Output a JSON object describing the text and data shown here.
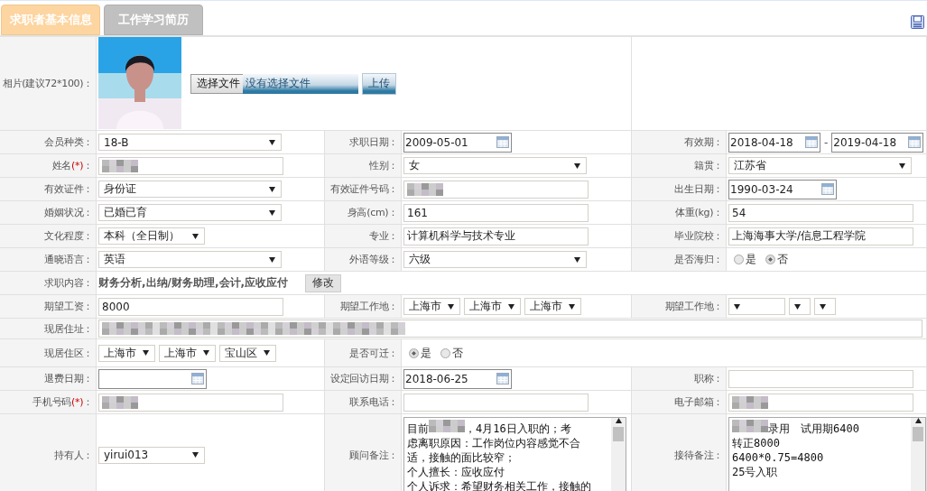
{
  "tabs": [
    {
      "label": "求职者基本信息",
      "selected": true
    },
    {
      "label": "工作学习简历",
      "selected": false
    }
  ],
  "photo": {
    "label": "相片(建议72*100)：",
    "file_button": "选择文件",
    "file_status": "没有选择文件",
    "upload_button": "上传"
  },
  "rows": [
    [
      {
        "label": "会员种类：",
        "field": {
          "kind": "select",
          "value": "18-B"
        }
      },
      {
        "label": "求职日期：",
        "field": {
          "kind": "date",
          "value": "2009-05-01"
        }
      },
      {
        "label": "有效期：",
        "field": {
          "kind": "daterange",
          "from": "2018-04-18",
          "separator": "-",
          "to": "2019-04-18"
        }
      }
    ],
    [
      {
        "label": "姓名",
        "mark": "(*)",
        "suffix": "：",
        "field": {
          "kind": "blurred"
        }
      },
      {
        "label": "性别：",
        "field": {
          "kind": "select",
          "value": "女"
        }
      },
      {
        "label": "籍贯：",
        "field": {
          "kind": "select",
          "value": "江苏省"
        }
      }
    ],
    [
      {
        "label": "有效证件：",
        "field": {
          "kind": "select",
          "value": "身份证"
        }
      },
      {
        "label": "有效证件号码：",
        "field": {
          "kind": "blurred"
        }
      },
      {
        "label": "出生日期：",
        "field": {
          "kind": "date",
          "value": "1990-03-24"
        }
      }
    ],
    [
      {
        "label": "婚姻状况：",
        "field": {
          "kind": "select",
          "value": "已婚已育"
        }
      },
      {
        "label": "身高(cm)：",
        "field": {
          "kind": "text",
          "value": "161"
        }
      },
      {
        "label": "体重(kg)：",
        "field": {
          "kind": "text",
          "value": "54"
        }
      }
    ],
    [
      {
        "label": "文化程度：",
        "field": {
          "kind": "select",
          "value": "本科（全日制）"
        }
      },
      {
        "label": "专业：",
        "field": {
          "kind": "text",
          "value": "计算机科学与技术专业"
        }
      },
      {
        "label": "毕业院校：",
        "field": {
          "kind": "text",
          "value": "上海海事大学/信息工程学院"
        }
      }
    ],
    [
      {
        "label": "通晓语言：",
        "field": {
          "kind": "select",
          "value": "英语"
        }
      },
      {
        "label": "外语等级：",
        "field": {
          "kind": "select",
          "value": "六级"
        }
      },
      {
        "label": "是否海归：",
        "field": {
          "kind": "radio",
          "options": [
            {
              "label": "是",
              "selected": false
            },
            {
              "label": "否",
              "selected": true
            }
          ]
        }
      }
    ],
    [
      {
        "label": "求职内容：",
        "field": {
          "kind": "summary",
          "value": "财务分析,出纳/财务助理,会计,应收应付",
          "button": "修改"
        }
      }
    ],
    [
      {
        "label": "期望工资：",
        "field": {
          "kind": "text",
          "value": "8000"
        }
      },
      {
        "label": "期望工作地：",
        "field": {
          "kind": "selects",
          "values": [
            "上海市",
            "上海市",
            "上海市"
          ]
        }
      },
      {
        "label": "期望工作地：",
        "field": {
          "kind": "selects",
          "boxes": [
            {
              "kind": "blank"
            },
            {
              "kind": "blank"
            },
            {
              "kind": "blank"
            }
          ]
        }
      }
    ],
    [
      {
        "label": "现居住址：",
        "field": {
          "kind": "blurred"
        }
      }
    ],
    [
      {
        "label": "现居住区：",
        "field": {
          "kind": "selects",
          "values": [
            "上海市",
            "上海市",
            "宝山区"
          ]
        }
      },
      {
        "label": "是否可迁：",
        "field": {
          "kind": "radio",
          "options": [
            {
              "label": "是",
              "selected": true
            },
            {
              "label": "否",
              "selected": false
            }
          ]
        }
      }
    ],
    [
      {
        "label": "退费日期：",
        "field": {
          "kind": "date"
        }
      },
      {
        "label": "设定回访日期：",
        "field": {
          "kind": "date",
          "value": "2018-06-25"
        }
      },
      {
        "label": "职称：",
        "field": {
          "kind": "text"
        }
      }
    ],
    [
      {
        "label": "手机号码",
        "mark": "(*)",
        "suffix": "：",
        "field": {
          "kind": "blurred"
        }
      },
      {
        "label": "联系电话：",
        "field": {
          "kind": "text"
        }
      },
      {
        "label": "电子邮箱：",
        "field": {
          "kind": "blurred"
        }
      }
    ],
    [
      {
        "label": "持有人：",
        "field": {
          "kind": "select",
          "value": "yirui013"
        }
      },
      {
        "label": "顾问备注：",
        "field": {
          "kind": "textarea",
          "lines": [
            [
              {
                "text": "目前"
              },
              {
                "kind": "blur"
              },
              {
                "text": "，4月16日入职的；考"
              }
            ],
            [
              {
                "text": "虑离职原因：工作岗位内容感觉不合"
              }
            ],
            [
              {
                "text": "适，接触的面比较窄；"
              }
            ],
            [
              {
                "text": "个人擅长：应收应付"
              }
            ],
            [
              {
                "text": "个人诉求：希望财务相关工作，接触的"
              }
            ]
          ]
        }
      },
      {
        "label": "接待备注：",
        "field": {
          "kind": "textarea",
          "lines": [
            [
              {
                "kind": "blur"
              },
              {
                "text": "录用　试用期6400"
              }
            ],
            [
              {
                "text": "转正8000"
              }
            ],
            [
              {
                "text": "6400*0.75=4800"
              }
            ],
            [
              {
                "text": "25号入职"
              }
            ]
          ]
        }
      }
    ]
  ]
}
